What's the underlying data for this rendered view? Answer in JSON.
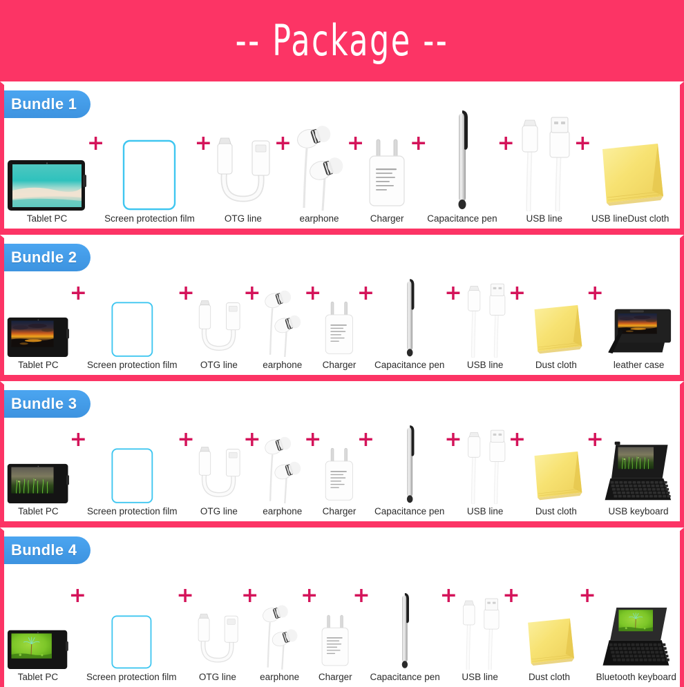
{
  "header": {
    "title": "-- Package --",
    "background_color": "#fc3465",
    "text_color": "#ffffff"
  },
  "theme": {
    "frame_pink": "#fc3465",
    "badge_blue": "#3d93e0",
    "plus_red": "#d4145a",
    "film_cyan": "#3fc6f0",
    "cloth_yellow": "#f7e06e",
    "caption_color": "#2b2b2b"
  },
  "plus_symbol": "+",
  "bundles": [
    {
      "badge": "Bundle 1",
      "items": [
        {
          "label": "Tablet PC",
          "icon": "tablet-icon",
          "screen": "beach"
        },
        {
          "label": "Screen protection film",
          "icon": "screen-film-icon"
        },
        {
          "label": "OTG line",
          "icon": "otg-cable-icon"
        },
        {
          "label": "earphone",
          "icon": "earphone-icon"
        },
        {
          "label": "Charger",
          "icon": "charger-icon"
        },
        {
          "label": "Capacitance pen",
          "icon": "stylus-pen-icon"
        },
        {
          "label": "USB line",
          "icon": "usb-cable-icon"
        },
        {
          "label": "USB lineDust cloth",
          "icon": "dust-cloth-icon"
        }
      ]
    },
    {
      "badge": "Bundle 2",
      "items": [
        {
          "label": "Tablet PC",
          "icon": "tablet-icon",
          "screen": "sunset"
        },
        {
          "label": "Screen protection film",
          "icon": "screen-film-icon"
        },
        {
          "label": "OTG line",
          "icon": "otg-cable-icon"
        },
        {
          "label": "earphone",
          "icon": "earphone-icon"
        },
        {
          "label": "Charger",
          "icon": "charger-icon"
        },
        {
          "label": "Capacitance pen",
          "icon": "stylus-pen-icon"
        },
        {
          "label": "USB line",
          "icon": "usb-cable-icon"
        },
        {
          "label": "Dust cloth",
          "icon": "dust-cloth-icon"
        },
        {
          "label": "leather case",
          "icon": "leather-case-icon",
          "screen": "sunset"
        }
      ]
    },
    {
      "badge": "Bundle 3",
      "items": [
        {
          "label": "Tablet PC",
          "icon": "tablet-icon",
          "screen": "grass"
        },
        {
          "label": "Screen protection film",
          "icon": "screen-film-icon"
        },
        {
          "label": "OTG line",
          "icon": "otg-cable-icon"
        },
        {
          "label": "earphone",
          "icon": "earphone-icon"
        },
        {
          "label": "Charger",
          "icon": "charger-icon"
        },
        {
          "label": "Capacitance pen",
          "icon": "stylus-pen-icon"
        },
        {
          "label": "USB line",
          "icon": "usb-cable-icon"
        },
        {
          "label": "Dust cloth",
          "icon": "dust-cloth-icon"
        },
        {
          "label": "USB keyboard",
          "icon": "usb-keyboard-icon",
          "screen": "grass"
        }
      ]
    },
    {
      "badge": "Bundle 4",
      "items": [
        {
          "label": "Tablet PC",
          "icon": "tablet-icon",
          "screen": "seedling"
        },
        {
          "label": "Screen protection film",
          "icon": "screen-film-icon"
        },
        {
          "label": "OTG line",
          "icon": "otg-cable-icon"
        },
        {
          "label": "earphone",
          "icon": "earphone-icon"
        },
        {
          "label": "Charger",
          "icon": "charger-icon"
        },
        {
          "label": "Capacitance pen",
          "icon": "stylus-pen-icon"
        },
        {
          "label": "USB line",
          "icon": "usb-cable-icon"
        },
        {
          "label": "Dust cloth",
          "icon": "dust-cloth-icon"
        },
        {
          "label": "Bluetooth keyboard",
          "icon": "bluetooth-keyboard-icon",
          "screen": "seedling"
        }
      ]
    }
  ]
}
